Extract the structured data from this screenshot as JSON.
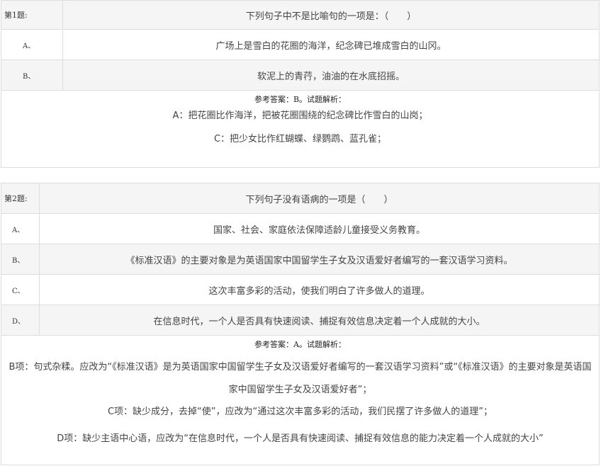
{
  "questions": [
    {
      "number_label": "第1题:",
      "stem": "下列句子中不是比喻句的一项是：（　　）",
      "options": [
        {
          "label": "A、",
          "text": "广场上是雪白的花圈的海洋，纪念碑已堆成雪白的山冈。"
        },
        {
          "label": "B、",
          "text": "软泥上的青荇，油油的在水底招摇。"
        }
      ],
      "answer_header": "参考答案：B。试题解析：",
      "explanation": [
        "A：把花圈比作海洋，把被花圈围绕的纪念碑比作雪白的山岗；",
        "C：把少女比作红蝴蝶、绿鹦鹉、蓝孔雀；"
      ]
    },
    {
      "number_label": "第2题:",
      "stem": "下列句子没有语病的一项是（　　）",
      "options": [
        {
          "label": "A、",
          "text": "国家、社会、家庭依法保障适龄儿童接受义务教育。"
        },
        {
          "label": "B、",
          "text": "《标准汉语》的主要对象是为英语国家中国留学生子女及汉语爱好者编写的一套汉语学习资料。"
        },
        {
          "label": "C、",
          "text": "这次丰富多彩的活动，使我们明白了许多做人的道理。"
        },
        {
          "label": "D、",
          "text": "在信息时代，一个人是否具有快速阅读、捕捉有效信息决定着一个人成就的大小。"
        }
      ],
      "answer_header": "参考答案：A。试题解析：",
      "explanation": [
        "B项：句式杂糅。应改为“《标准汉语》是为英语国家中国留学生子女及汉语爱好者编写的一套汉语学习资料”或“《标准汉语》的主要对象是英语国家中国留学生子女及汉语爱好者”；",
        "C项：缺少成分，去掉“使”，应改为“通过这次丰富多彩的活动，我们民摆了许多做人的道理”；",
        "D项：缺少主语中心语，应改为“在信息时代，一个人是否具有快速阅读、捕捉有效信息的能力决定着一个人成就的大小”"
      ]
    }
  ]
}
